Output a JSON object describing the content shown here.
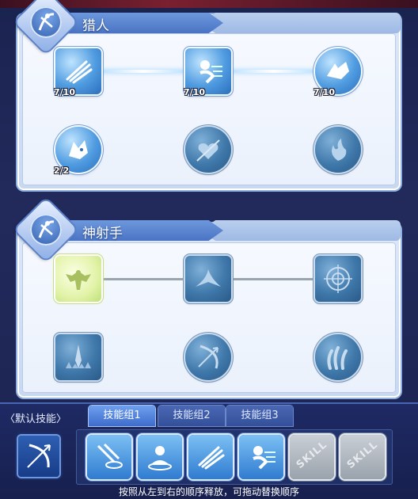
{
  "sections": [
    {
      "title": "猎人",
      "skills": [
        {
          "icon": "claw-icon",
          "count": "7/10"
        },
        {
          "icon": "dash-icon",
          "count": "7/10"
        },
        {
          "icon": "wolf-icon",
          "count": "7/10"
        },
        {
          "icon": "beast-icon",
          "count": "2/2"
        },
        {
          "icon": "heart-strike-icon",
          "count": ""
        },
        {
          "icon": "fire-spirit-icon",
          "count": ""
        }
      ]
    },
    {
      "title": "神射手",
      "skills": [
        {
          "icon": "eagle-icon",
          "count": ""
        },
        {
          "icon": "hawk-icon",
          "count": ""
        },
        {
          "icon": "target-icon",
          "count": ""
        },
        {
          "icon": "crystal-spikes-icon",
          "count": ""
        },
        {
          "icon": "bow-icon",
          "count": ""
        },
        {
          "icon": "flame-claw-icon",
          "count": ""
        }
      ]
    }
  ],
  "bottom_bar": {
    "default_skill_label": "〈默认技能〉",
    "tabs": [
      "技能组1",
      "技能组2",
      "技能组3"
    ],
    "active_tab": 0,
    "slots": [
      {
        "icon": "arrow-rain-icon",
        "filled": true
      },
      {
        "icon": "meditate-icon",
        "filled": true
      },
      {
        "icon": "claw-icon",
        "filled": true
      },
      {
        "icon": "dash-icon",
        "filled": true
      },
      {
        "icon": "empty-skill-icon",
        "filled": false,
        "text": "SKILL"
      },
      {
        "icon": "empty-skill-icon",
        "filled": false,
        "text": "SKILL"
      }
    ],
    "hint": "按照从左到右的顺序释放，可拖动替换顺序"
  }
}
